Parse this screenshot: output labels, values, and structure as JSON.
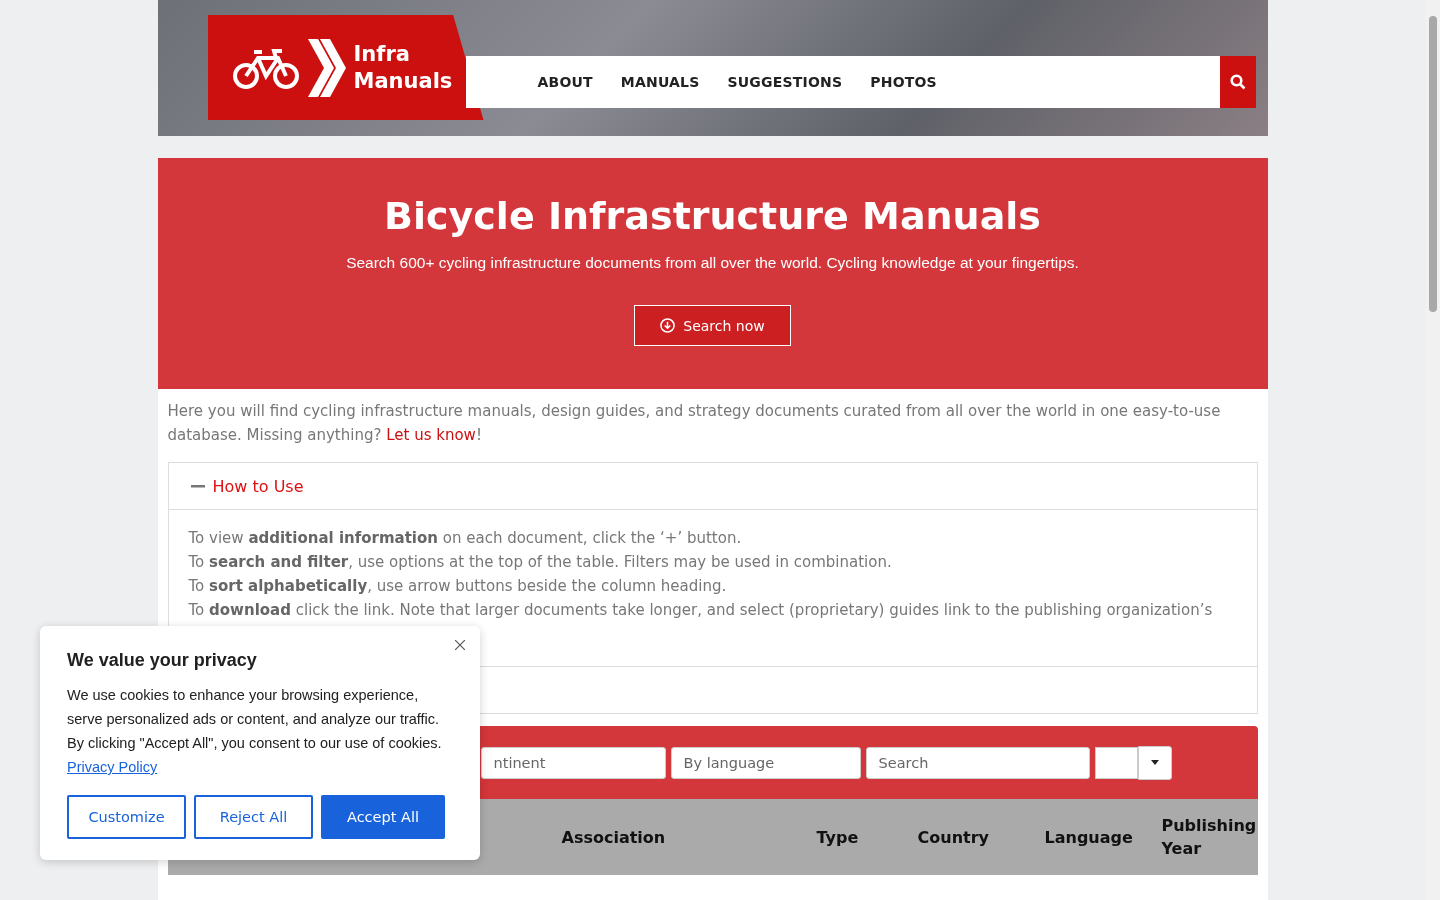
{
  "header": {
    "logo_line1": "Infra",
    "logo_line2": "Manuals",
    "nav": [
      {
        "label": "ABOUT"
      },
      {
        "label": "MANUALS"
      },
      {
        "label": "SUGGESTIONS"
      },
      {
        "label": "PHOTOS"
      }
    ]
  },
  "hero": {
    "title": "Bicycle Infrastructure Manuals",
    "subtitle": "Search 600+ cycling infrastructure documents from all over the world. Cycling knowledge at your fingertips.",
    "button": "Search now"
  },
  "intro": {
    "text": "Here you will find cycling infrastructure manuals, design guides, and strategy documents curated from all over the world in one easy-to-use database. Missing anything? ",
    "link": "Let us know",
    "after": "!"
  },
  "accordion": [
    {
      "title": "How to Use",
      "expanded": true,
      "lines": [
        "To view **additional information** on each document, click the ‘+’ button.",
        "To **search and filter**, use options at the top of the table. Filters may be used in combination.",
        "To **sort alphabetically**, use arrow buttons beside the column heading.",
        "To **download** click the link. Note that larger documents take longer, and select (proprietary) guides link to the publishing organization’s"
      ]
    }
  ],
  "filters": [
    {
      "placeholder": "ntinent"
    },
    {
      "placeholder": "By language"
    },
    {
      "placeholder": "Search"
    }
  ],
  "table": {
    "columns": [
      "",
      "",
      "Association",
      "Type",
      "Country",
      "Language",
      "Publishing Year"
    ]
  },
  "cookie_banner": {
    "title": "We value your privacy",
    "text": "We use cookies to enhance your browsing experience, serve personalized ads or content, and analyze our traffic. By clicking \"Accept All\", you consent to our use of cookies. ",
    "link": "Privacy Policy",
    "buttons": [
      {
        "label": "Customize",
        "kind": "outline"
      },
      {
        "label": "Reject All",
        "kind": "outline"
      },
      {
        "label": "Accept All",
        "kind": "primary"
      }
    ]
  }
}
